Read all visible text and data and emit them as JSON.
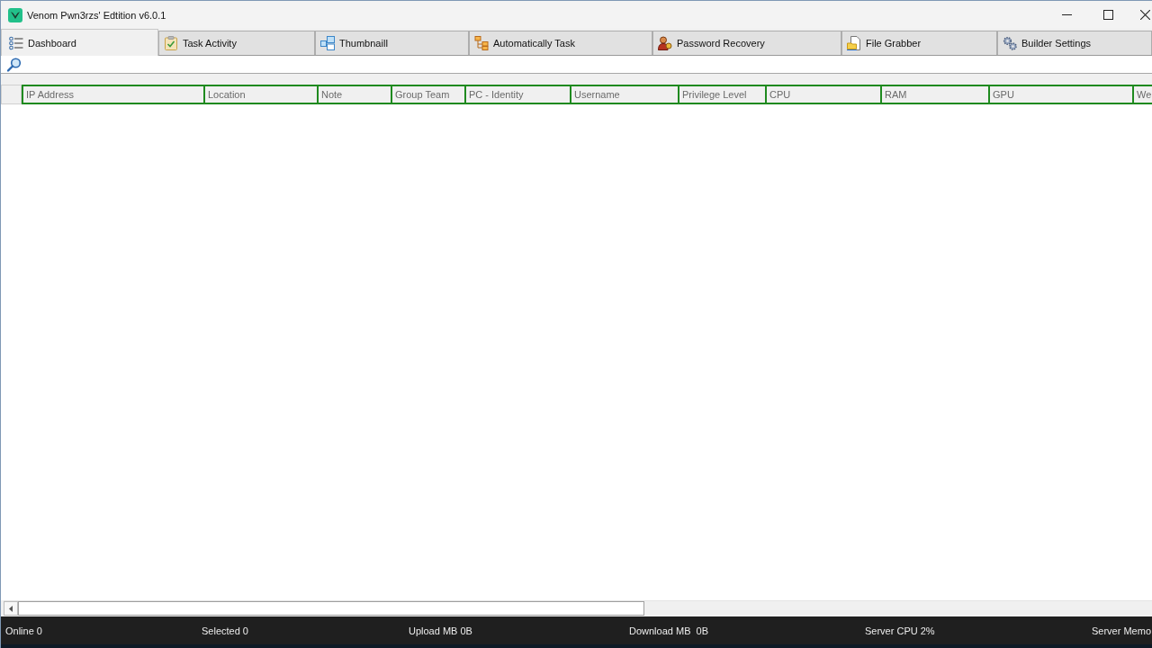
{
  "window": {
    "title": "Venom Pwn3rzs' Edtition v6.0.1"
  },
  "tabs": [
    {
      "label": "Dashboard",
      "selected": true
    },
    {
      "label": "Task Activity",
      "selected": false
    },
    {
      "label": "ThumbnailI",
      "selected": false
    },
    {
      "label": "Automatically Task",
      "selected": false
    },
    {
      "label": "Password Recovery",
      "selected": false
    },
    {
      "label": "File Grabber",
      "selected": false
    },
    {
      "label": "Builder Settings",
      "selected": false
    }
  ],
  "table": {
    "columns": [
      "IP Address",
      "Location",
      "Note",
      "Group Team",
      "PC - Identity",
      "Username",
      "Privilege Level",
      "CPU",
      "RAM",
      "GPU",
      "We"
    ]
  },
  "status_bar": [
    "Online 0",
    "Selected 0",
    "Upload MB 0B",
    "Download MB  0B",
    "Server CPU 2%",
    "Server Memo"
  ]
}
